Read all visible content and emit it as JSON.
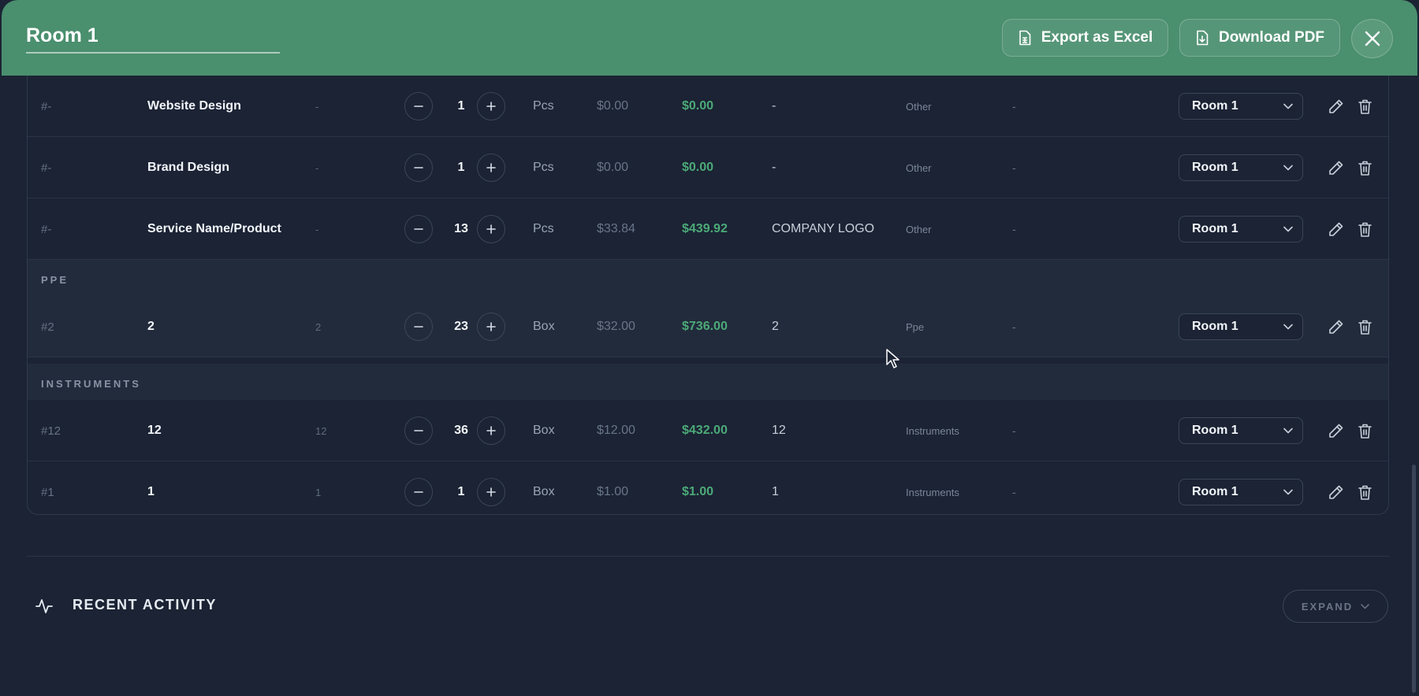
{
  "header": {
    "title": "Room 1",
    "export_label": "Export as Excel",
    "download_label": "Download PDF"
  },
  "rows_top": [
    {
      "id": "#-",
      "name": "Website Design",
      "sku": "-",
      "qty": "1",
      "unit": "Pcs",
      "price": "$0.00",
      "total": "$0.00",
      "brand": "-",
      "category": "Other",
      "note": "-",
      "room": "Room 1"
    },
    {
      "id": "#-",
      "name": "Brand Design",
      "sku": "-",
      "qty": "1",
      "unit": "Pcs",
      "price": "$0.00",
      "total": "$0.00",
      "brand": "-",
      "category": "Other",
      "note": "-",
      "room": "Room 1"
    },
    {
      "id": "#-",
      "name": "Service Name/Product",
      "sku": "-",
      "qty": "13",
      "unit": "Pcs",
      "price": "$33.84",
      "total": "$439.92",
      "brand": "COMPANY LOGO",
      "category": "Other",
      "note": "-",
      "room": "Room 1"
    }
  ],
  "sections": [
    {
      "label": "PPE",
      "rows": [
        {
          "id": "#2",
          "name": "2",
          "sku": "2",
          "qty": "23",
          "unit": "Box",
          "price": "$32.00",
          "total": "$736.00",
          "brand": "2",
          "category": "Ppe",
          "note": "-",
          "room": "Room 1"
        }
      ]
    },
    {
      "label": "INSTRUMENTS",
      "rows": [
        {
          "id": "#12",
          "name": "12",
          "sku": "12",
          "qty": "36",
          "unit": "Box",
          "price": "$12.00",
          "total": "$432.00",
          "brand": "12",
          "category": "Instruments",
          "note": "-",
          "room": "Room 1"
        },
        {
          "id": "#1",
          "name": "1",
          "sku": "1",
          "qty": "1",
          "unit": "Box",
          "price": "$1.00",
          "total": "$1.00",
          "brand": "1",
          "category": "Instruments",
          "note": "-",
          "room": "Room 1"
        }
      ]
    }
  ],
  "activity": {
    "title": "RECENT ACTIVITY",
    "expand_label": "EXPAND"
  },
  "icons": {
    "export": "spreadsheet-file-icon",
    "download": "download-file-icon",
    "close": "close-icon",
    "minus": "minus-icon",
    "plus": "plus-icon",
    "dropdown": "chevron-down-icon",
    "edit": "pencil-icon",
    "delete": "trash-icon",
    "activity": "pulse-icon"
  },
  "colors": {
    "header_bg": "#4a8f6e",
    "page_bg": "#1b2334",
    "section_bg": "#222b3c",
    "total_green": "#4caa78"
  }
}
